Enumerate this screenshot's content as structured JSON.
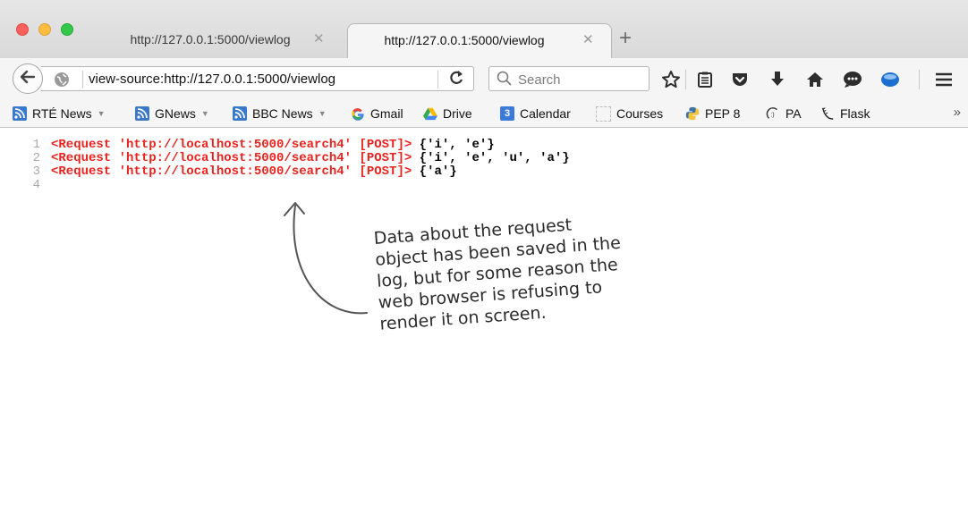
{
  "window": {
    "traffic_lights": [
      "close",
      "minimize",
      "zoom"
    ]
  },
  "tabs": [
    {
      "title": "http://127.0.0.1:5000/viewlog",
      "close_icon": "close-icon",
      "active": false
    },
    {
      "title": "http://127.0.0.1:5000/viewlog",
      "close_icon": "close-icon",
      "active": true
    }
  ],
  "newtab": {
    "label": "+"
  },
  "navbar": {
    "url": "view-source:http://127.0.0.1:5000/viewlog",
    "reload_label": "C",
    "search_placeholder": "Search",
    "icons": [
      "star-icon",
      "reading-list-icon",
      "pocket-icon",
      "download-icon",
      "home-icon",
      "chat-icon",
      "extension-icon",
      "menu-icon"
    ]
  },
  "bookmarks": [
    {
      "label": "RTÉ News",
      "icon": "rss-icon",
      "dropdown": true
    },
    {
      "label": "GNews",
      "icon": "rss-icon",
      "dropdown": true
    },
    {
      "label": "BBC News",
      "icon": "rss-icon",
      "dropdown": true
    },
    {
      "label": "Gmail",
      "icon": "google-icon",
      "dropdown": false
    },
    {
      "label": "Drive",
      "icon": "drive-icon",
      "dropdown": false
    },
    {
      "label": "Calendar",
      "icon": "calendar-icon",
      "icon_text": "3",
      "dropdown": false
    },
    {
      "label": "Courses",
      "icon": "blank-page-icon",
      "dropdown": false
    },
    {
      "label": "PEP 8",
      "icon": "python-icon",
      "dropdown": false
    },
    {
      "label": "PA",
      "icon": "pythonanywhere-icon",
      "dropdown": false
    },
    {
      "label": "Flask",
      "icon": "flask-icon",
      "dropdown": false
    }
  ],
  "bookmarks_overflow": "»",
  "source": {
    "lines": [
      {
        "num": "1",
        "tag": "<Request 'http://localhost:5000/search4' [POST]>",
        "text": " {'i', 'e'}"
      },
      {
        "num": "2",
        "tag": "<Request 'http://localhost:5000/search4' [POST]>",
        "text": " {'i', 'e', 'u', 'a'}"
      },
      {
        "num": "3",
        "tag": "<Request 'http://localhost:5000/search4' [POST]>",
        "text": " {'a'}"
      },
      {
        "num": "4",
        "tag": "",
        "text": ""
      }
    ]
  },
  "annotation": {
    "lines": [
      "Data about the request",
      "object has been saved in the",
      "log, but for some reason the",
      "web browser is refusing to",
      "render it on screen."
    ]
  },
  "colors": {
    "tag_red": "#e8231e",
    "line_number_gray": "#aaaaaa"
  }
}
